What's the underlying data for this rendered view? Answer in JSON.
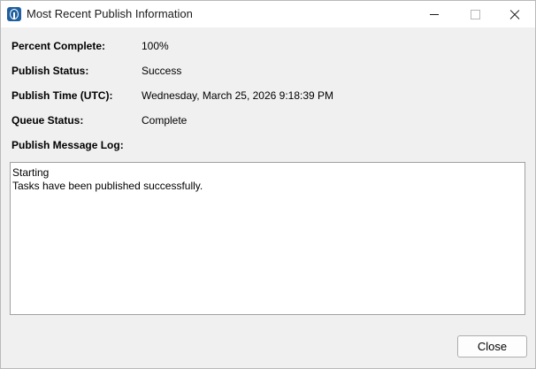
{
  "window": {
    "title": "Most Recent Publish Information"
  },
  "fields": {
    "percent_complete": {
      "label": "Percent Complete:",
      "value": "100%"
    },
    "publish_status": {
      "label": "Publish Status:",
      "value": "Success"
    },
    "publish_time": {
      "label": "Publish Time (UTC):",
      "value": "Wednesday, March 25, 2026 9:18:39 PM"
    },
    "queue_status": {
      "label": "Queue Status:",
      "value": "Complete"
    },
    "message_log": {
      "label": "Publish Message Log:"
    }
  },
  "log": {
    "lines": [
      "Starting",
      "Tasks have been published successfully."
    ]
  },
  "buttons": {
    "close_label": "Close"
  },
  "icons": {
    "app": "app-logo-icon",
    "minimize": "minimize-icon",
    "maximize": "maximize-icon",
    "close": "close-icon"
  }
}
